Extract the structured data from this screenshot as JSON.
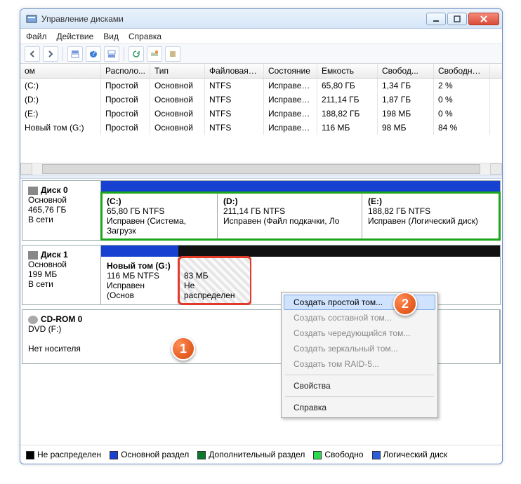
{
  "title": "Управление дисками",
  "menu": {
    "file": "Файл",
    "action": "Действие",
    "view": "Вид",
    "help": "Справка"
  },
  "columns": [
    "ом",
    "Располо...",
    "Тип",
    "Файловая с...",
    "Состояние",
    "Емкость",
    "Свобод...",
    "Свободно %"
  ],
  "rows": [
    {
      "name": "(C:)",
      "layout": "Простой",
      "type": "Основной",
      "fs": "NTFS",
      "status": "Исправен...",
      "cap": "65,80 ГБ",
      "free": "1,34 ГБ",
      "pct": "2 %"
    },
    {
      "name": "(D:)",
      "layout": "Простой",
      "type": "Основной",
      "fs": "NTFS",
      "status": "Исправен...",
      "cap": "211,14 ГБ",
      "free": "1,87 ГБ",
      "pct": "0 %"
    },
    {
      "name": "(E:)",
      "layout": "Простой",
      "type": "Основной",
      "fs": "NTFS",
      "status": "Исправен...",
      "cap": "188,82 ГБ",
      "free": "198 МБ",
      "pct": "0 %"
    },
    {
      "name": "Новый том  (G:)",
      "layout": "Простой",
      "type": "Основной",
      "fs": "NTFS",
      "status": "Исправен...",
      "cap": "116 МБ",
      "free": "98 МБ",
      "pct": "84 %"
    }
  ],
  "disks": {
    "d0": {
      "name": "Диск 0",
      "type": "Основной",
      "size": "465,76 ГБ",
      "status": "В сети",
      "parts": [
        {
          "label": "(C:)",
          "info": "65,80 ГБ NTFS",
          "stat": "Исправен (Система, Загрузк"
        },
        {
          "label": "(D:)",
          "info": "211,14 ГБ NTFS",
          "stat": "Исправен (Файл подкачки, Ло"
        },
        {
          "label": "(E:)",
          "info": "188,82 ГБ NTFS",
          "stat": "Исправен (Логический диск)"
        }
      ]
    },
    "d1": {
      "name": "Диск 1",
      "type": "Основной",
      "size": "199 МБ",
      "status": "В сети",
      "parts": [
        {
          "label": "Новый том  (G:)",
          "info": "116 МБ NTFS",
          "stat": "Исправен (Основ"
        },
        {
          "label": "",
          "info": "83 МБ",
          "stat": "Не распределен"
        }
      ]
    },
    "cd": {
      "name": "CD-ROM 0",
      "type": "DVD (F:)",
      "status": "Нет носителя"
    }
  },
  "legend": {
    "unalloc": "Не распределен",
    "primary": "Основной раздел",
    "extended": "Дополнительный раздел",
    "free": "Свободно",
    "logical": "Логический диск"
  },
  "ctx": {
    "simple": "Создать простой том...",
    "spanned": "Создать составной том...",
    "striped": "Создать чередующийся том...",
    "mirrored": "Создать зеркальный том...",
    "raid5": "Создать том RAID-5...",
    "props": "Свойства",
    "help": "Справка"
  },
  "badges": {
    "b1": "1",
    "b2": "2"
  }
}
